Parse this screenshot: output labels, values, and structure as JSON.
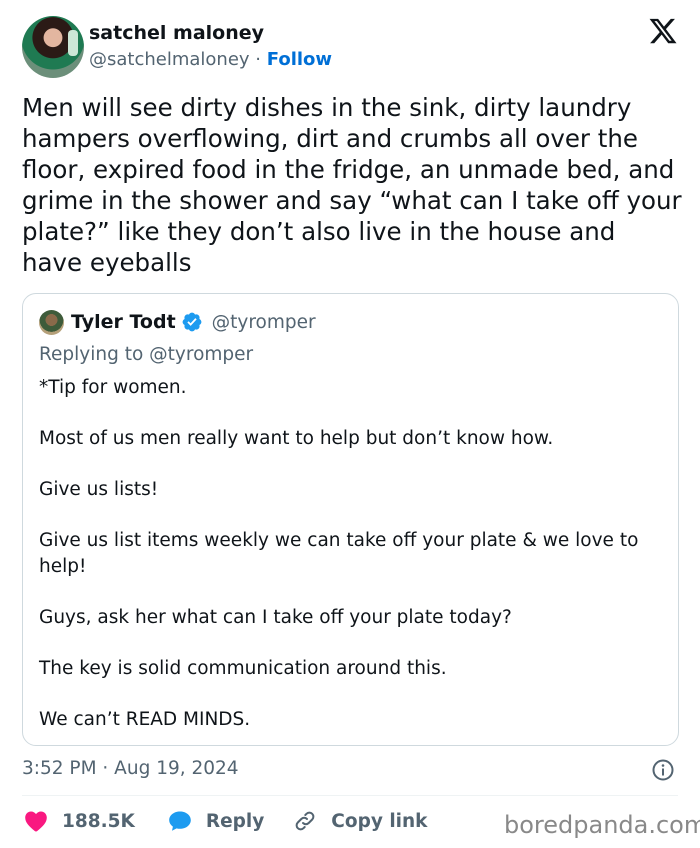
{
  "author": {
    "name": "satchel maloney",
    "handle": "@satchelmaloney",
    "separator": "·",
    "follow_label": "Follow"
  },
  "tweet_text": "Men will see dirty dishes in the sink, dirty laundry hampers overflowing, dirt and crumbs all over the floor, expired food in the fridge, an unmade bed, and grime in the shower and say “what can I take off your plate?” like they don’t also live in the house and have eyeballs",
  "quoted": {
    "name": "Tyler Todt",
    "handle": "@tyromper",
    "replying_to": "Replying to @tyromper",
    "paragraphs": [
      "*Tip for women.",
      "Most of us men really want to help but don’t know how.",
      "Give us lists!",
      "Give us list items weekly we can take off your plate & we love to help!",
      "Guys, ask her what can I take off your plate today?",
      "The key is solid communication around this.",
      "We can’t READ MINDS."
    ]
  },
  "timestamp": "3:52 PM · Aug 19, 2024",
  "actions": {
    "likes": "188.5K",
    "reply_label": "Reply",
    "copy_link_label": "Copy link"
  },
  "watermark": "boredpanda.com",
  "colors": {
    "accent": "#006fd6",
    "heart": "#f91880",
    "reply_bubble": "#1d9bf0",
    "muted": "#536471"
  }
}
